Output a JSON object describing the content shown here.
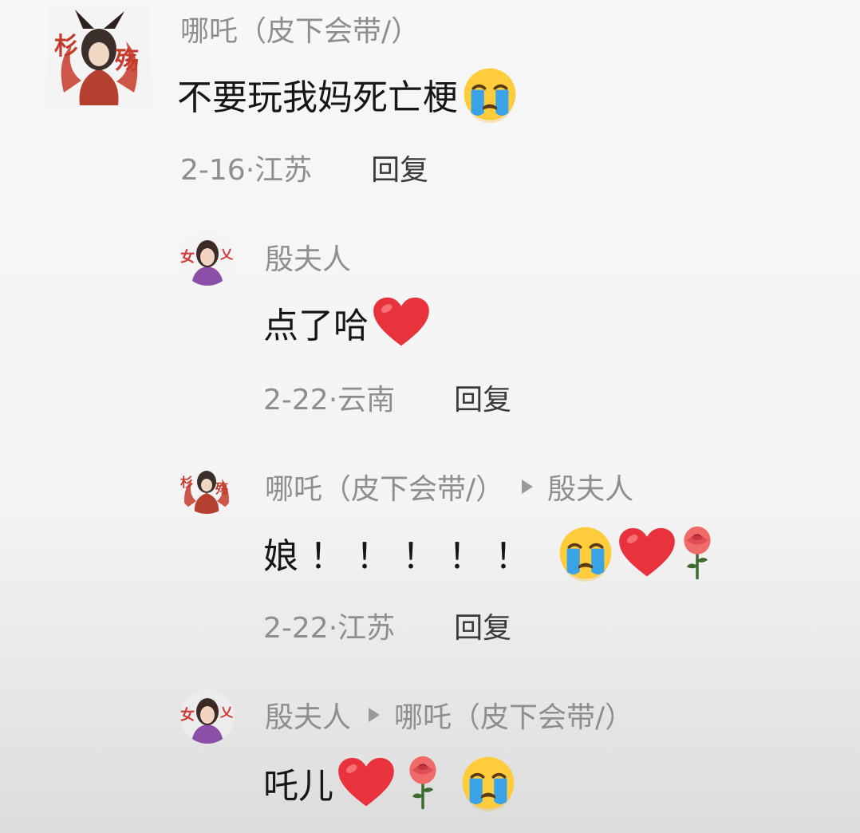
{
  "comments": [
    {
      "username": "哪吒（皮下会带/）",
      "text": "不要玩我妈死亡梗",
      "emojis": [
        "crying-face"
      ],
      "date_location": "2-16·江苏",
      "reply_label": "回复"
    },
    {
      "username": "殷夫人",
      "text": "点了哈",
      "emojis": [
        "red-heart"
      ],
      "date_location": "2-22·云南",
      "reply_label": "回复"
    },
    {
      "username": "哪吒（皮下会带/）",
      "reply_to": "殷夫人",
      "text": "娘！！！！！",
      "emojis": [
        "crying-face",
        "red-heart",
        "rose"
      ],
      "date_location": "2-22·江苏",
      "reply_label": "回复"
    },
    {
      "username": "殷夫人",
      "reply_to": "哪吒（皮下会带/）",
      "text": "吒儿",
      "emojis": [
        "red-heart",
        "rose",
        "crying-face"
      ]
    }
  ],
  "colors": {
    "username": "#8e8e8e",
    "text": "#161616",
    "reply": "#3a3a3a",
    "heart": "#e8323c",
    "tear": "#3aa3e8",
    "face": "#ffcd3c"
  }
}
